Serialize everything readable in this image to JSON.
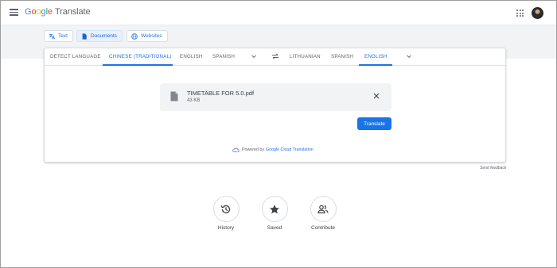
{
  "header": {
    "logo_letters": [
      "G",
      "o",
      "o",
      "g",
      "l",
      "e"
    ],
    "product": "Translate",
    "menu_icon": "hamburger-menu-icon",
    "apps_icon": "apps-grid-icon"
  },
  "modes": [
    {
      "label": "Text",
      "icon": "translate-text-icon",
      "active": false
    },
    {
      "label": "Documents",
      "icon": "document-icon",
      "active": true
    },
    {
      "label": "Websites",
      "icon": "globe-icon",
      "active": false
    }
  ],
  "source_langs": [
    {
      "label": "DETECT LANGUAGE",
      "active": false
    },
    {
      "label": "CHINESE (TRADITIONAL)",
      "active": true
    },
    {
      "label": "ENGLISH",
      "active": false
    },
    {
      "label": "SPANISH",
      "active": false
    }
  ],
  "target_langs": [
    {
      "label": "LITHUANIAN",
      "active": false
    },
    {
      "label": "SPANISH",
      "active": false
    },
    {
      "label": "ENGLISH",
      "active": true
    }
  ],
  "file": {
    "name": "TIMETABLE FOR 5.0.pdf",
    "size": "43 KB"
  },
  "translate_button": "Translate",
  "powered_by": {
    "prefix": "Powered by",
    "link": "Google Cloud Translation"
  },
  "send_feedback": "Send feedback",
  "actions": [
    {
      "label": "History",
      "icon": "history-icon"
    },
    {
      "label": "Saved",
      "icon": "star-icon"
    },
    {
      "label": "Contribute",
      "icon": "people-icon"
    }
  ],
  "colors": {
    "accent": "#1a73e8",
    "band": "#f1f3f4",
    "file_box": "#f1f3f4"
  }
}
